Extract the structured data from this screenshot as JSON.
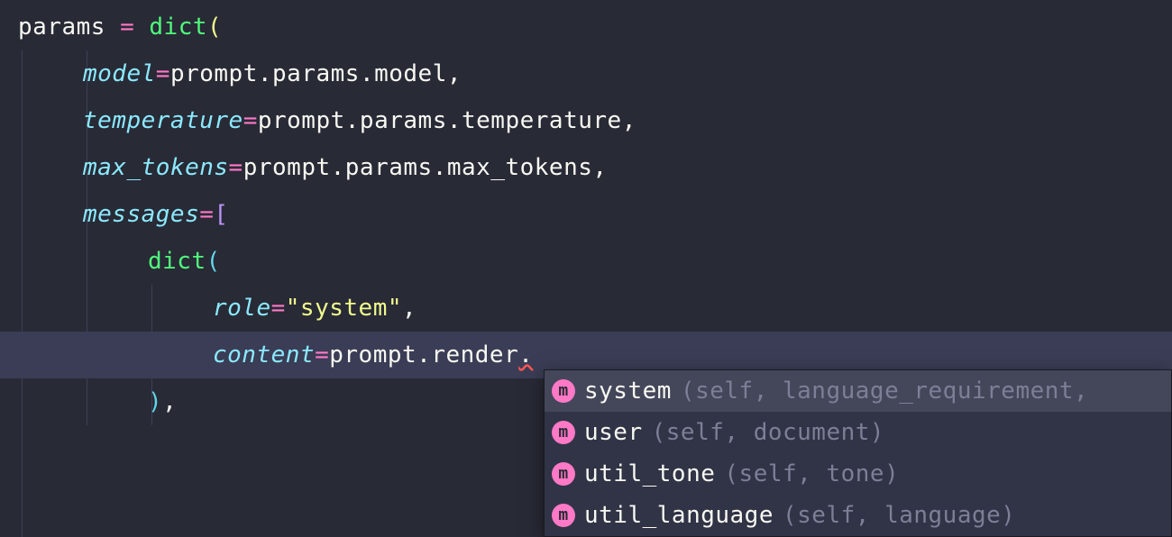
{
  "code": {
    "l1": {
      "params": "params",
      "eq": " = ",
      "dict": "dict",
      "open": "("
    },
    "l2": {
      "arg": "model",
      "eq": "=",
      "obj": "prompt",
      "dot1": ".",
      "p1": "params",
      "dot2": ".",
      "p2": "model",
      "comma": ","
    },
    "l3": {
      "arg": "temperature",
      "eq": "=",
      "obj": "prompt",
      "dot1": ".",
      "p1": "params",
      "dot2": ".",
      "p2": "temperature",
      "comma": ","
    },
    "l4": {
      "arg": "max_tokens",
      "eq": "=",
      "obj": "prompt",
      "dot1": ".",
      "p1": "params",
      "dot2": ".",
      "p2": "max_tokens",
      "comma": ","
    },
    "l5": {
      "arg": "messages",
      "eq": "=",
      "open": "["
    },
    "l6": {
      "dict": "dict",
      "open": "("
    },
    "l7": {
      "arg": "role",
      "eq": "=",
      "str": "\"system\"",
      "comma": ","
    },
    "l8": {
      "arg": "content",
      "eq": "=",
      "obj": "prompt",
      "dot1": ".",
      "p1": "render",
      "dot2": "."
    },
    "l9": {
      "close": ")",
      "comma": ","
    }
  },
  "autocomplete": {
    "icon_letter": "m",
    "items": [
      {
        "name": "system",
        "sig": "(self, language_requirement,"
      },
      {
        "name": "user",
        "sig": "(self, document)"
      },
      {
        "name": "util_tone",
        "sig": "(self, tone)"
      },
      {
        "name": "util_language",
        "sig": "(self, language)"
      }
    ]
  }
}
